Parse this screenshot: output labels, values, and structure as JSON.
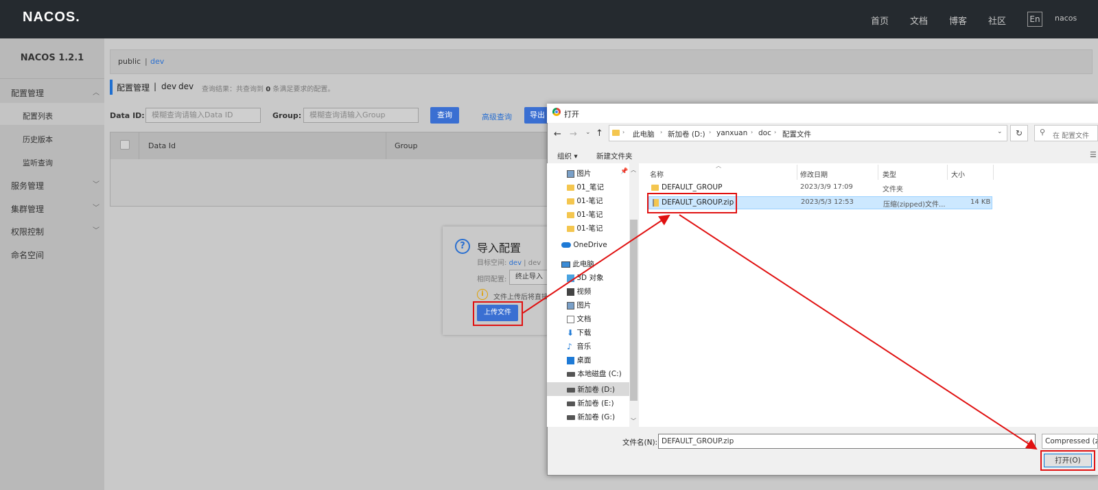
{
  "topbar": {
    "logo": "NACOS.",
    "nav": [
      "首页",
      "文档",
      "博客",
      "社区"
    ],
    "lang": "En",
    "user": "nacos"
  },
  "sidebar": {
    "title": "NACOS 1.2.1",
    "items": [
      {
        "label": "配置管理",
        "children": [
          "配置列表",
          "历史版本",
          "监听查询"
        ]
      },
      {
        "label": "服务管理"
      },
      {
        "label": "集群管理"
      },
      {
        "label": "权限控制"
      },
      {
        "label": "命名空间"
      }
    ]
  },
  "namespace": {
    "public": "public",
    "sep": "|",
    "dev": "dev"
  },
  "page": {
    "title": "配置管理",
    "sep": "|",
    "ns_name": "dev",
    "ns_id": "dev",
    "query_prefix": "查询结果：共查询到",
    "query_count": "0",
    "query_suffix": "条满足要求的配置。"
  },
  "search": {
    "dataid_label": "Data ID:",
    "dataid_placeholder": "模糊查询请输入Data ID",
    "group_label": "Group:",
    "group_placeholder": "模糊查询请输入Group",
    "query_btn": "查询",
    "advanced_link": "高级查询",
    "export_btn": "导出"
  },
  "table": {
    "headers": [
      "Data Id",
      "Group"
    ]
  },
  "import_dialog": {
    "title": "导入配置",
    "target_label": "目标空间:",
    "target_ns": "dev",
    "target_sep": "|",
    "target_id": "dev",
    "same_label": "相同配置:",
    "same_value": "终止导入",
    "warning": "文件上传后将直接",
    "upload_btn": "上传文件"
  },
  "file_dialog": {
    "title": "打开",
    "path": [
      "此电脑",
      "新加卷 (D:)",
      "yanxuan",
      "doc",
      "配置文件"
    ],
    "search_placeholder": "在 配置文件",
    "organize": "组织 ▾",
    "new_folder": "新建文件夹",
    "tree": [
      {
        "label": "图片",
        "icon": "picture-icon"
      },
      {
        "label": "01_笔记",
        "icon": "folder-icon"
      },
      {
        "label": "01-笔记",
        "icon": "folder-icon"
      },
      {
        "label": "01-笔记",
        "icon": "folder-icon"
      },
      {
        "label": "01-笔记",
        "icon": "folder-icon"
      },
      {
        "label": "OneDrive",
        "icon": "cloud-icon"
      },
      {
        "label": "此电脑",
        "icon": "computer-icon"
      },
      {
        "label": "3D 对象",
        "icon": "cube-icon"
      },
      {
        "label": "视频",
        "icon": "video-icon"
      },
      {
        "label": "图片",
        "icon": "picture-icon"
      },
      {
        "label": "文档",
        "icon": "document-icon"
      },
      {
        "label": "下载",
        "icon": "download-icon"
      },
      {
        "label": "音乐",
        "icon": "music-icon"
      },
      {
        "label": "桌面",
        "icon": "desktop-icon"
      },
      {
        "label": "本地磁盘 (C:)",
        "icon": "drive-icon"
      },
      {
        "label": "新加卷 (D:)",
        "icon": "drive-icon"
      },
      {
        "label": "新加卷 (E:)",
        "icon": "drive-icon"
      },
      {
        "label": "新加卷 (G:)",
        "icon": "drive-icon"
      }
    ],
    "columns": [
      "名称",
      "修改日期",
      "类型",
      "大小"
    ],
    "files": [
      {
        "name": "DEFAULT_GROUP",
        "date": "2023/3/9 17:09",
        "type": "文件夹",
        "size": ""
      },
      {
        "name": "DEFAULT_GROUP.zip",
        "date": "2023/5/3 12:53",
        "type": "压缩(zipped)文件...",
        "size": "14 KB"
      }
    ],
    "filename_label": "文件名(N):",
    "filename_value": "DEFAULT_GROUP.zip",
    "filetype": "Compressed (zi",
    "open_btn": "打开(O)"
  },
  "colors": {
    "accent": "#3a6fd2",
    "annotation": "#e01010",
    "topbar": "#252a2f"
  }
}
